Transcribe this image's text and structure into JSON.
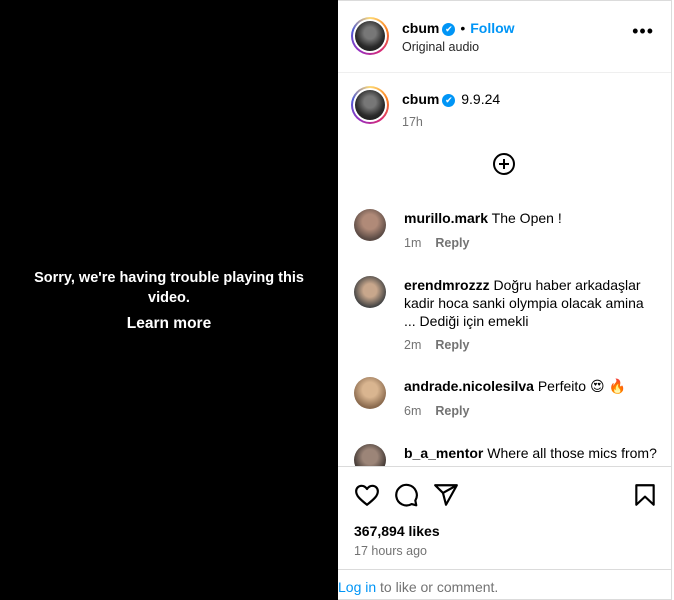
{
  "video": {
    "error_message": "Sorry, we're having trouble playing this video.",
    "learn_more": "Learn more"
  },
  "header": {
    "username": "cbum",
    "dot": "•",
    "follow_label": "Follow",
    "subtitle": "Original audio",
    "more_label": "•••"
  },
  "caption": {
    "username": "cbum",
    "text": "9.9.24",
    "time": "17h"
  },
  "comments": [
    {
      "username": "murillo.mark",
      "text": "The Open !",
      "time": "1m",
      "reply": "Reply"
    },
    {
      "username": "erendmrozzz",
      "text": "Doğru haber arkadaşlar kadir hoca sanki olympia olacak amina ... Dediği için emekli",
      "time": "2m",
      "reply": "Reply"
    },
    {
      "username": "andrade.nicolesilva",
      "text": "Perfeito 😍 🔥",
      "time": "6m",
      "reply": "Reply"
    },
    {
      "username": "b_a_mentor",
      "text": "Where all those mics from?",
      "time": "",
      "reply": ""
    }
  ],
  "stats": {
    "likes": "367,894 likes",
    "posted": "17 hours ago"
  },
  "login": {
    "link": "Log in",
    "rest": " to like or comment."
  },
  "colors": {
    "accent": "#0095f6",
    "muted": "#737373",
    "video_bg": "#000000"
  },
  "icons": [
    "verified-badge-icon",
    "more-options-icon",
    "add-comment-icon",
    "heart-icon",
    "comment-icon",
    "share-icon",
    "bookmark-icon"
  ]
}
